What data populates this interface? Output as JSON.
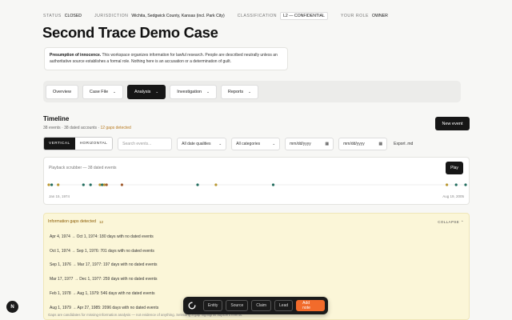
{
  "meta": {
    "status_label": "STATUS",
    "status_value": "CLOSED",
    "jurisdiction_label": "JURISDICTION",
    "jurisdiction_value": "Wichita, Sedgwick County, Kansas (incl. Park City)",
    "classification_label": "CLASSIFICATION",
    "classification_value": "L2 — CONFIDENTIAL",
    "role_label": "YOUR ROLE",
    "role_value": "OWNER"
  },
  "title": "Second Trace Demo Case",
  "notice": {
    "bold": "Presumption of innocence.",
    "text": " This workspace organizes information for lawful research. People are described neutrally unless an authoritative source establishes a formal role. Nothing here is an accusation or a determination of guilt."
  },
  "nav": {
    "tabs": [
      {
        "label": "Overview",
        "chev": ""
      },
      {
        "label": "Case File",
        "chev": "⌄"
      },
      {
        "label": "Analysis",
        "chev": "⌄"
      },
      {
        "label": "Investigation",
        "chev": "⌄"
      },
      {
        "label": "Reports",
        "chev": "⌄"
      }
    ]
  },
  "timeline": {
    "title": "Timeline",
    "sub_counts": "38 events · 38 dated accounts · ",
    "sub_gaps": "12 gaps detected",
    "new_event": "New event",
    "view_vertical": "VERTICAL",
    "view_horizontal": "HORIZONTAL",
    "search_placeholder": "Search events...",
    "qualities": "All date qualities",
    "categories": "All categories",
    "date_from": "mm/dd/yyyy",
    "date_to": "mm/dd/yyyy",
    "export": "Export .md"
  },
  "scrubber": {
    "label": "Playback scrubber — 38 dated events",
    "play": "Play",
    "start_date": "Jan 15, 1974",
    "end_date": "Aug 19, 2005"
  },
  "gaps": {
    "header": "Information gaps detected",
    "count": "12",
    "collapse": "COLLAPSE",
    "items": [
      "Apr 4, 1974 → Oct 1, 1974: 180 days with no dated events",
      "Oct 1, 1974 → Sep 1, 1976: 701 days with no dated events",
      "Sep 1, 1976 → Mar 17, 1977: 197 days with no dated events",
      "Mar 17, 1977 → Dec 1, 1977: 259 days with no dated events",
      "Feb 1, 1978 → Aug 1, 1979: 546 days with no dated events",
      "Aug 1, 1979 → Apr 27, 1985: 2096 days with no dated events"
    ],
    "footer": "Gaps are candidates for missing-information analysis — not evidence of anything. Selecting a gap highlights adjacent events."
  },
  "dock": {
    "entity": "Entity",
    "source": "Source",
    "claim": "Claim",
    "lead": "Lead",
    "add_note": "Add note"
  },
  "logo": "N",
  "colors": {
    "accent": "#f26b2b",
    "gap_text": "#b7791f",
    "event_green": "#1f6b5c",
    "event_gold": "#b8962e",
    "event_brown": "#a05a2c"
  },
  "events": [
    {
      "date": "1974-01-15",
      "cat": "gold"
    },
    {
      "date": "1974-04-04",
      "cat": "green"
    },
    {
      "date": "1974-10-01",
      "cat": "gold"
    },
    {
      "date": "1976-09-01",
      "cat": "green"
    },
    {
      "date": "1977-03-17",
      "cat": "green"
    },
    {
      "date": "1977-12-01",
      "cat": "gold"
    },
    {
      "date": "1978-02-01",
      "cat": "green"
    },
    {
      "date": "1978-04-01",
      "cat": "gold"
    },
    {
      "date": "1978-06-01",
      "cat": "brown"
    },
    {
      "date": "1979-08-01",
      "cat": "brown"
    },
    {
      "date": "1985-04-27",
      "cat": "green"
    },
    {
      "date": "1986-09-16",
      "cat": "gold"
    },
    {
      "date": "1991-01-19",
      "cat": "green"
    },
    {
      "date": "2004-03-19",
      "cat": "gold"
    },
    {
      "date": "2004-12-01",
      "cat": "green"
    },
    {
      "date": "2005-08-19",
      "cat": "green"
    }
  ]
}
